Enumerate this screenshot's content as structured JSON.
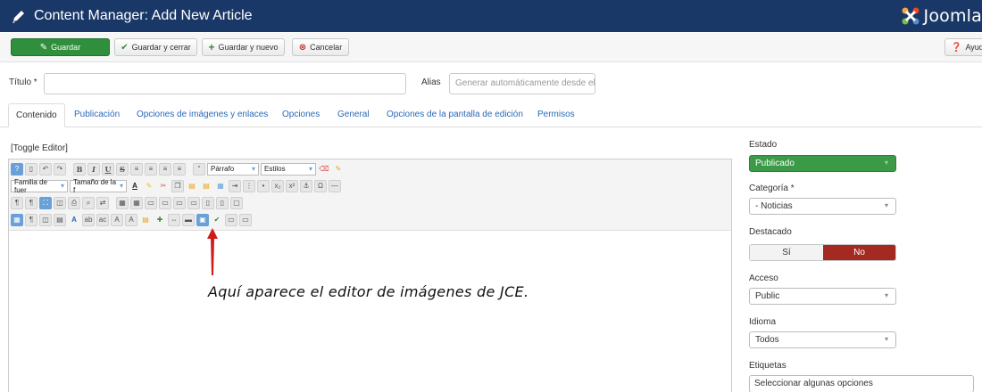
{
  "header": {
    "title": "Content Manager: Add New Article",
    "brand": "Joomla"
  },
  "toolbar": {
    "save": "Guardar",
    "save_close": "Guardar y cerrar",
    "save_new": "Guardar y nuevo",
    "cancel": "Cancelar",
    "help": "Ayuda"
  },
  "form": {
    "title_label": "Título *",
    "alias_label": "Alias",
    "alias_placeholder": "Generar automáticamente desde el"
  },
  "tabs": [
    "Contenido",
    "Publicación",
    "Opciones de imágenes y enlaces",
    "Opciones",
    "General",
    "Opciones de la pantalla de edición",
    "Permisos"
  ],
  "editor": {
    "toggle": "[Toggle Editor]",
    "format_select": "Párrafo",
    "styles_select": "Estilos",
    "font_family": "Familia de fuer",
    "font_size": "Tamaño de la f",
    "annotation": "Aquí  aparece el editor de imágenes de JCE."
  },
  "sidebar": {
    "status_label": "Estado",
    "status_value": "Publicado",
    "category_label": "Categoría *",
    "category_value": "- Noticias",
    "featured_label": "Destacado",
    "featured_yes": "Sí",
    "featured_no": "No",
    "access_label": "Acceso",
    "access_value": "Public",
    "language_label": "Idioma",
    "language_value": "Todos",
    "tags_label": "Etiquetas",
    "tags_placeholder": "Seleccionar algunas opciones"
  },
  "colors": {
    "header": "#1a3867",
    "save": "#2f8f3c",
    "published": "#3a9a45",
    "no": "#a42a21",
    "arrow": "#d11a1a"
  }
}
